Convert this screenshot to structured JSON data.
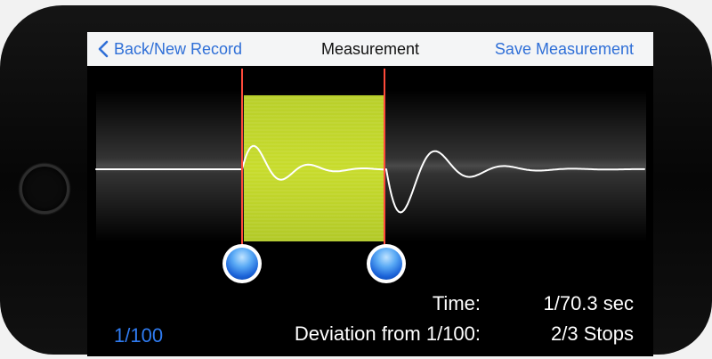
{
  "nav": {
    "back_label": "Back/New Record",
    "title": "Measurement",
    "save_label": "Save Measurement"
  },
  "measurement": {
    "time_label": "Time:",
    "time_value": "1/70.3 sec",
    "deviation_label": "Deviation from 1/100:",
    "deviation_value": "2/3 Stops"
  },
  "shutter_setting": "1/100",
  "colors": {
    "accent": "#2f6fd7",
    "highlight": "#c4d92b",
    "marker": "#ff4a3a",
    "waveform": "#ffffff"
  },
  "icons": {
    "back": "chevron-left-icon",
    "marker_handle": "blue-sphere-handle"
  }
}
